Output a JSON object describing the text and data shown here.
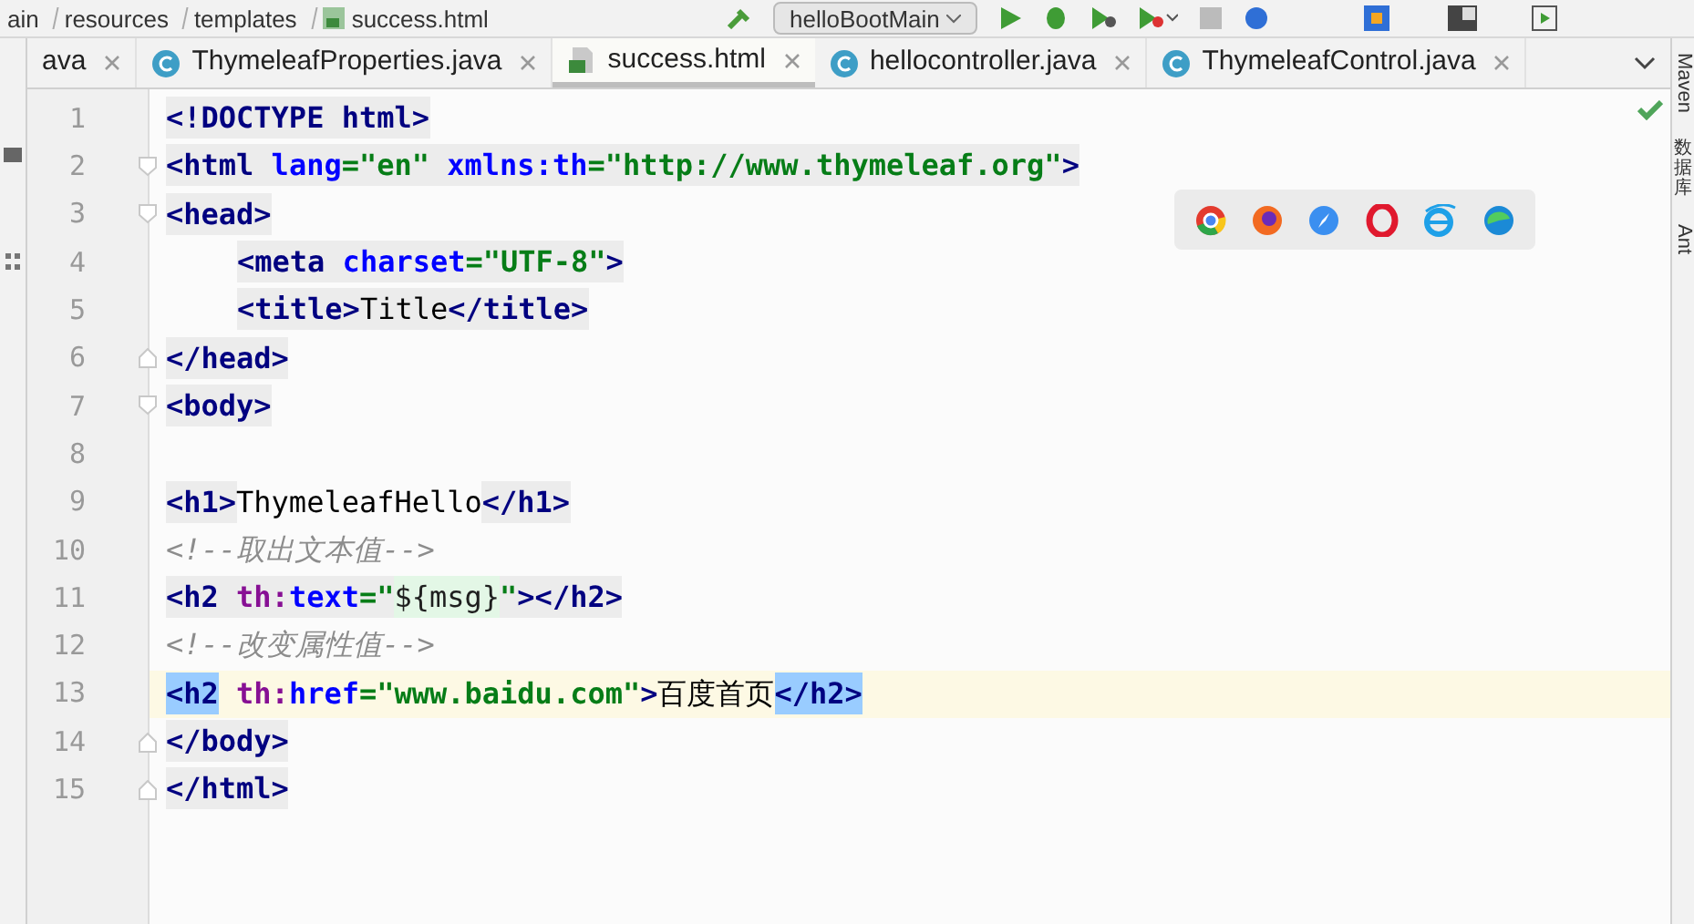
{
  "breadcrumb": [
    "ain",
    "resources",
    "templates",
    "success.html"
  ],
  "run_config": "helloBootMain",
  "tabs": [
    {
      "label": "ava",
      "selected": false
    },
    {
      "label": "ThymeleafProperties.java",
      "kind": "java",
      "selected": false
    },
    {
      "label": "success.html",
      "kind": "html",
      "selected": true
    },
    {
      "label": "hellocontroller.java",
      "kind": "java",
      "selected": false
    },
    {
      "label": "ThymeleafControl.java",
      "kind": "java",
      "selected": false
    }
  ],
  "right_tools": [
    "Maven",
    "数据库",
    "Ant"
  ],
  "lines": [
    {
      "number": "1",
      "current": false,
      "tokens": [
        {
          "kind": "tag",
          "text": "<!DOCTYPE "
        },
        {
          "kind": "tag",
          "text": "html"
        },
        {
          "kind": "tag",
          "text": ">"
        }
      ]
    },
    {
      "number": "2",
      "current": false,
      "fold_open": true,
      "tokens": [
        {
          "kind": "tag",
          "text": "<html"
        },
        {
          "kind": "attr",
          "text": " lang"
        },
        {
          "kind": "value",
          "text": "=\"en\""
        },
        {
          "kind": "attr",
          "text": " xmlns:th"
        },
        {
          "kind": "value",
          "text": "=\"http://www.thymeleaf.org\""
        },
        {
          "kind": "tag",
          "text": ">"
        }
      ]
    },
    {
      "number": "3",
      "current": false,
      "fold_open": true,
      "tokens": [
        {
          "kind": "tag",
          "text": "<head>"
        }
      ]
    },
    {
      "number": "4",
      "current": false,
      "indented": true,
      "tokens": [
        {
          "kind": "tag",
          "text": "<meta"
        },
        {
          "kind": "attr",
          "text": " charset"
        },
        {
          "kind": "value",
          "text": "=\"UTF-8\""
        },
        {
          "kind": "tag",
          "text": ">"
        }
      ]
    },
    {
      "number": "5",
      "current": false,
      "indented": true,
      "tokens": [
        {
          "kind": "tag",
          "text": "<title>"
        },
        {
          "kind": "inner",
          "text": "Title"
        },
        {
          "kind": "tag",
          "text": "</title>"
        }
      ]
    },
    {
      "number": "6",
      "current": false,
      "fold_close": true,
      "tokens": [
        {
          "kind": "tag",
          "text": "</head>"
        }
      ]
    },
    {
      "number": "7",
      "current": false,
      "fold_open": true,
      "tokens": [
        {
          "kind": "tag",
          "text": "<body>"
        }
      ]
    },
    {
      "number": "8",
      "current": false
    },
    {
      "number": "9",
      "current": false,
      "tokens": [
        {
          "kind": "tag",
          "text": "<h1>"
        },
        {
          "kind": "text",
          "text": "ThymeleafHello"
        },
        {
          "kind": "tag",
          "text": "</h1>"
        }
      ]
    },
    {
      "number": "10",
      "current": false,
      "tokens": [
        {
          "kind": "comment",
          "text": "<!--取出文本值-->"
        }
      ]
    },
    {
      "number": "11",
      "current": false,
      "tokens": [
        {
          "kind": "tag",
          "text": "<h2"
        },
        {
          "kind": "ns",
          "text": " th:"
        },
        {
          "kind": "attr",
          "text": "text"
        },
        {
          "kind": "value",
          "text": "=\""
        },
        {
          "kind": "expr",
          "text": "${msg}"
        },
        {
          "kind": "value",
          "text": "\""
        },
        {
          "kind": "tag",
          "text": "></h2>"
        }
      ]
    },
    {
      "number": "12",
      "current": false,
      "tokens": [
        {
          "kind": "comment",
          "text": "<!--改变属性值-->"
        }
      ]
    },
    {
      "number": "13",
      "current": true,
      "tokens": [
        {
          "kind": "matched",
          "text": "<h2"
        },
        {
          "kind": "ns",
          "text": " th:"
        },
        {
          "kind": "attr",
          "text": "href"
        },
        {
          "kind": "value",
          "text": "=\"www.baidu.com\""
        },
        {
          "kind": "tag",
          "text": ">"
        },
        {
          "kind": "text",
          "text": "百度首页"
        },
        {
          "kind": "matched",
          "text": "</h2>"
        }
      ]
    },
    {
      "number": "14",
      "current": false,
      "fold_close": true,
      "tokens": [
        {
          "kind": "tag",
          "text": "</body>"
        }
      ]
    },
    {
      "number": "15",
      "current": false,
      "fold_close": true,
      "tokens": [
        {
          "kind": "tag",
          "text": "</html>"
        }
      ]
    }
  ]
}
